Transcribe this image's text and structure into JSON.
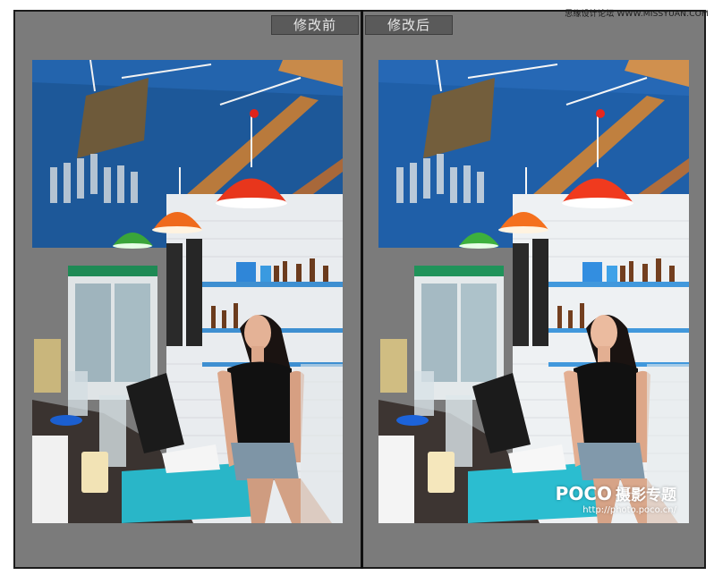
{
  "window": {
    "left_label": "修改前",
    "right_label": "修改后"
  },
  "watermark": {
    "top_right": "思缘设计论坛 WWW.MISSYUAN.COM",
    "poco_brand": "POCO",
    "poco_zh": "摄影专题",
    "poco_url": "http://photo.poco.cn/"
  },
  "colors": {
    "ceiling_before": "#1e5a9c",
    "ceiling_after": "#1f5fa8",
    "lamp_red": "#e8361c",
    "lamp_orange": "#ef6a1c",
    "lamp_green": "#3aa53a",
    "tissue_box": "#29b6c8",
    "panel_bg": "#7b7b7b"
  },
  "photo": {
    "subject": "woman-sitting-at-bar-counter",
    "variants": [
      "before",
      "after"
    ]
  }
}
